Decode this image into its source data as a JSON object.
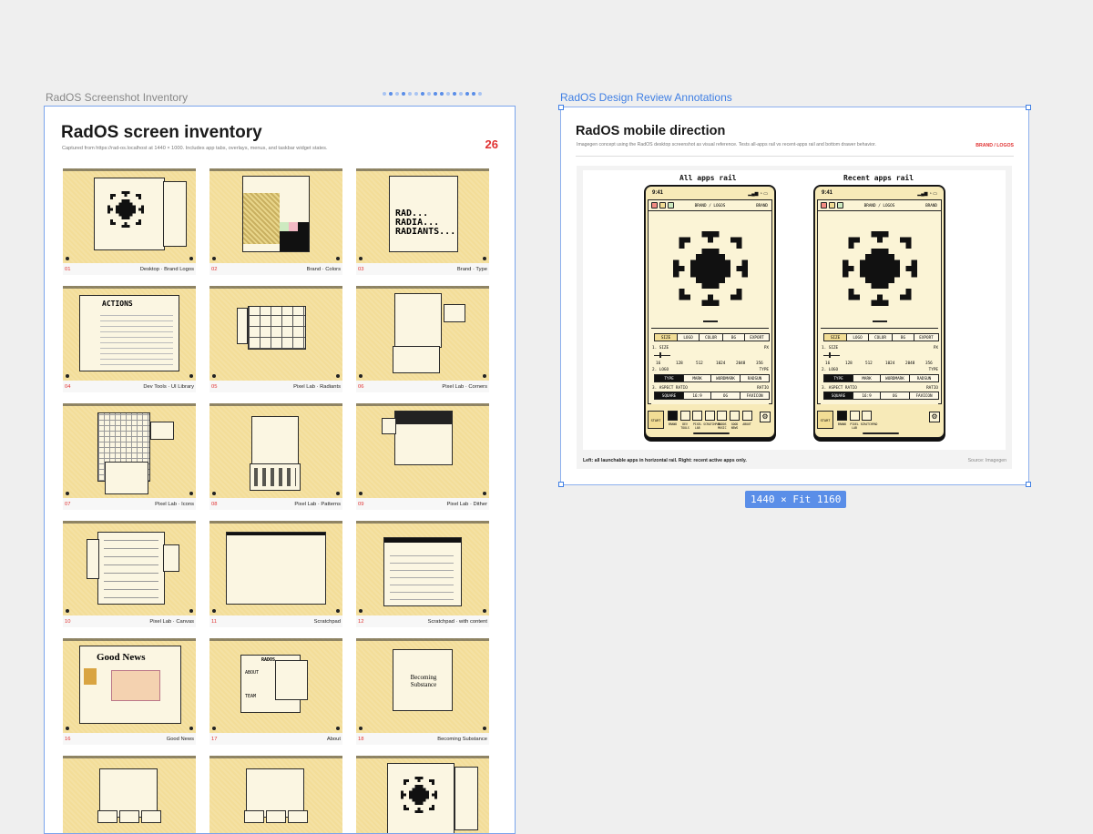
{
  "canvas": {
    "left_frame_label": "RadOS Screenshot Inventory",
    "right_frame_label": "RadOS Design Review Annotations",
    "size_badge": "1440 × Fit 1160",
    "accent": "#3f7fe4"
  },
  "inventory": {
    "title": "RadOS screen inventory",
    "subtitle": "Captured from https://rad-os.localhost at 1440 × 1000. Includes app tabs, overlays, menus, and taskbar widget states.",
    "count": "26",
    "items": [
      {
        "num": "01",
        "caption": "Desktop · Brand Logos"
      },
      {
        "num": "02",
        "caption": "Brand · Colors"
      },
      {
        "num": "03",
        "caption": "Brand · Type"
      },
      {
        "num": "04",
        "caption": "Dev Tools · UI Library"
      },
      {
        "num": "05",
        "caption": "Pixel Lab · Radiants"
      },
      {
        "num": "06",
        "caption": "Pixel Lab · Corners"
      },
      {
        "num": "07",
        "caption": "Pixel Lab · Icons"
      },
      {
        "num": "08",
        "caption": "Pixel Lab · Patterns"
      },
      {
        "num": "09",
        "caption": "Pixel Lab · Dither"
      },
      {
        "num": "10",
        "caption": "Pixel Lab · Canvas"
      },
      {
        "num": "11",
        "caption": "Scratchpad"
      },
      {
        "num": "12",
        "caption": "Scratchpad · with content"
      },
      {
        "num": "16",
        "caption": "Good News"
      },
      {
        "num": "17",
        "caption": "About"
      },
      {
        "num": "18",
        "caption": "Becoming Substance"
      },
      {
        "num": "",
        "caption": ""
      },
      {
        "num": "",
        "caption": ""
      },
      {
        "num": "",
        "caption": ""
      }
    ],
    "thumb_texts": {
      "actions": "ACTIONS",
      "rad": "RAD...",
      "radia": "RADIA...",
      "radiants": "RADIANTS...",
      "good_news": "Good News",
      "about_brand": "RADOS",
      "about": "ABOUT",
      "team": "TEAM",
      "becoming": "Becoming Substance"
    }
  },
  "review": {
    "title": "RadOS mobile direction",
    "subtitle": "Imagegen concept using the RadOS desktop screenshot as visual reference. Tests all-apps rail vs recent-apps rail and bottom drawer behavior.",
    "tag": "BRAND / LOGOS",
    "caption": "Left: all launchable apps in horizontal rail. Right: recent active apps only.",
    "source": "Source: Imagegen",
    "phones": [
      {
        "heading": "All apps rail",
        "time": "9:41",
        "window_title": "BRAND / LOGOS",
        "window_brand": "BRAND",
        "tabs": [
          "SIZE",
          "LOGO",
          "COLOR",
          "BG",
          "EXPORT"
        ],
        "size_label": "1. SIZE",
        "size_unit": "PX",
        "sizes": [
          "16",
          "128",
          "512",
          "1024",
          "2048",
          "356"
        ],
        "logo_label": "2. LOGO",
        "logo_right": "TYPE",
        "logo_opts": [
          "TYPE",
          "MARK",
          "WORDMARK",
          "RADSUN"
        ],
        "ratio_label": "3. ASPECT RATIO",
        "ratio_right": "RATIO",
        "ratio_opts": [
          "SQUARE",
          "16:9",
          "OG",
          "FAVICON"
        ],
        "start": "START",
        "apps": [
          "BRAND",
          "DEV TOOLS",
          "PIXEL LAB",
          "SCRATCHPAD",
          "RADOS MUSIC",
          "GOOD NEWS",
          "ABOUT"
        ]
      },
      {
        "heading": "Recent apps rail",
        "time": "9:41",
        "window_title": "BRAND / LOGOS",
        "window_brand": "BRAND",
        "tabs": [
          "SIZE",
          "LOGO",
          "COLOR",
          "BG",
          "EXPORT"
        ],
        "size_label": "1. SIZE",
        "size_unit": "PX",
        "sizes": [
          "16",
          "128",
          "512",
          "1024",
          "2048",
          "356"
        ],
        "logo_label": "2. LOGO",
        "logo_right": "TYPE",
        "logo_opts": [
          "TYPE",
          "MARK",
          "WORDMARK",
          "RADSUN"
        ],
        "ratio_label": "3. ASPECT RATIO",
        "ratio_right": "RATIO",
        "ratio_opts": [
          "SQUARE",
          "16:9",
          "OG",
          "FAVICON"
        ],
        "start": "START",
        "apps": [
          "BRAND",
          "PIXEL LAB",
          "SCRATCHPAD"
        ]
      }
    ]
  }
}
